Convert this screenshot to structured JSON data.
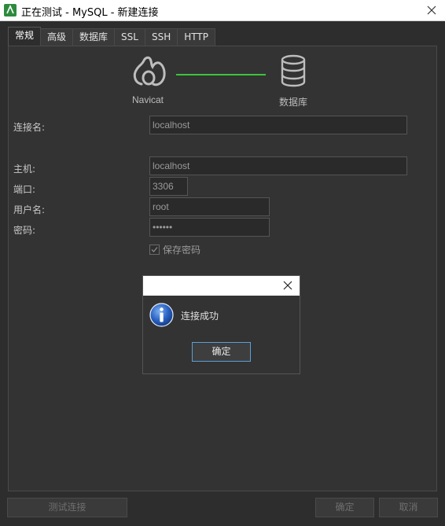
{
  "window": {
    "title": "正在测试 - MySQL - 新建连接"
  },
  "tabs": [
    {
      "label": "常规",
      "active": true
    },
    {
      "label": "高级",
      "active": false
    },
    {
      "label": "数据库",
      "active": false
    },
    {
      "label": "SSL",
      "active": false
    },
    {
      "label": "SSH",
      "active": false
    },
    {
      "label": "HTTP",
      "active": false
    }
  ],
  "header": {
    "navicat_label": "Navicat",
    "db_label": "数据库",
    "line_color": "#3cc43c"
  },
  "form": {
    "connection_name_label": "连接名:",
    "connection_name_value": "localhost",
    "host_label": "主机:",
    "host_value": "localhost",
    "port_label": "端口:",
    "port_value": "3306",
    "username_label": "用户名:",
    "username_value": "root",
    "password_label": "密码:",
    "password_value": "••••••",
    "save_password_label": "保存密码",
    "save_password_checked": true
  },
  "buttons": {
    "test_connection": "测试连接",
    "ok": "确定",
    "cancel": "取消"
  },
  "dialog": {
    "message": "连接成功",
    "ok_label": "确定",
    "icon": "info-icon"
  }
}
